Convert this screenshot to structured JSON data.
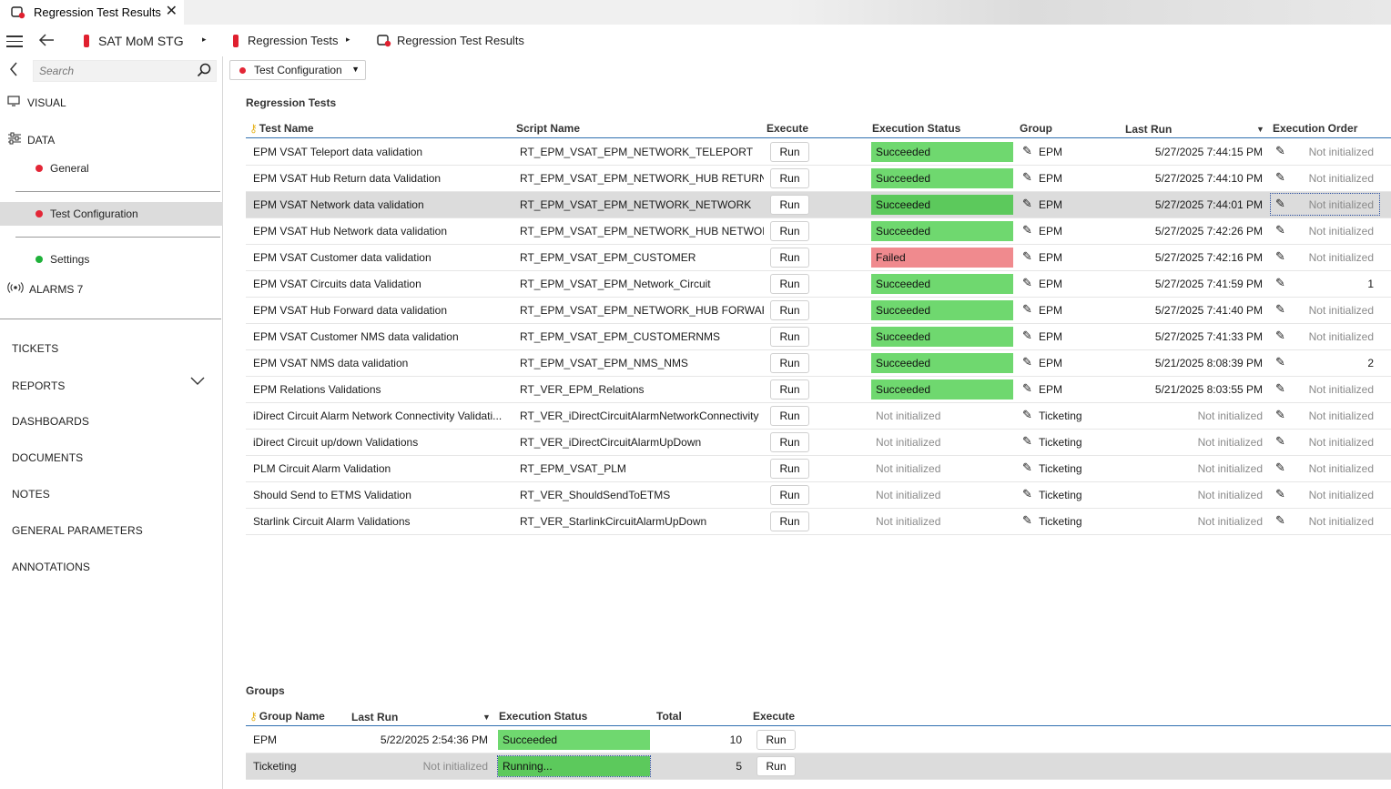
{
  "tab": {
    "title": "Regression Test Results",
    "close": "✕"
  },
  "breadcrumb": {
    "items": [
      "SAT MoM STG",
      "Regression Tests",
      "Regression Test Results"
    ],
    "separator": "▸"
  },
  "sidebar": {
    "search_placeholder": "Search",
    "visual": "VISUAL",
    "data": "DATA",
    "data_items": [
      {
        "label": "General",
        "status": "red"
      },
      {
        "label": "Test Configuration",
        "status": "red",
        "selected": true
      },
      {
        "label": "Settings",
        "status": "green"
      }
    ],
    "alarms": "ALARMS 7",
    "menu": [
      "TICKETS",
      "REPORTS",
      "DASHBOARDS",
      "DOCUMENTS",
      "NOTES",
      "GENERAL PARAMETERS",
      "ANNOTATIONS"
    ]
  },
  "main": {
    "dropdown_label": "Test Configuration",
    "tests_title": "Regression Tests",
    "tests_columns": [
      "Test Name",
      "Script Name",
      "Execute",
      "Execution Status",
      "Group",
      "Last Run",
      "Execution Order"
    ],
    "tests": [
      {
        "name": "EPM VSAT Teleport data validation",
        "script": "RT_EPM_VSAT_EPM_NETWORK_TELEPORT",
        "execute": "Run",
        "status": "Succeeded",
        "group": "EPM",
        "last_run": "5/27/2025 7:44:15 PM",
        "order": "Not initialized"
      },
      {
        "name": "EPM VSAT Hub Return data Validation",
        "script": "RT_EPM_VSAT_EPM_NETWORK_HUB RETURN",
        "execute": "Run",
        "status": "Succeeded",
        "group": "EPM",
        "last_run": "5/27/2025 7:44:10 PM",
        "order": "Not initialized"
      },
      {
        "name": "EPM VSAT Network data validation",
        "script": "RT_EPM_VSAT_EPM_NETWORK_NETWORK",
        "execute": "Run",
        "status": "Succeeded",
        "group": "EPM",
        "last_run": "5/27/2025 7:44:01 PM",
        "order": "Not initialized"
      },
      {
        "name": "EPM VSAT Hub Network data validation",
        "script": "RT_EPM_VSAT_EPM_NETWORK_HUB NETWORK",
        "execute": "Run",
        "status": "Succeeded",
        "group": "EPM",
        "last_run": "5/27/2025 7:42:26 PM",
        "order": "Not initialized"
      },
      {
        "name": "EPM VSAT Customer data validation",
        "script": "RT_EPM_VSAT_EPM_CUSTOMER",
        "execute": "Run",
        "status": "Failed",
        "group": "EPM",
        "last_run": "5/27/2025 7:42:16 PM",
        "order": "Not initialized"
      },
      {
        "name": "EPM VSAT Circuits data Validation",
        "script": "RT_EPM_VSAT_EPM_Network_Circuit",
        "execute": "Run",
        "status": "Succeeded",
        "group": "EPM",
        "last_run": "5/27/2025 7:41:59 PM",
        "order": "1"
      },
      {
        "name": "EPM VSAT Hub Forward data validation",
        "script": "RT_EPM_VSAT_EPM_NETWORK_HUB FORWARD",
        "execute": "Run",
        "status": "Succeeded",
        "group": "EPM",
        "last_run": "5/27/2025 7:41:40 PM",
        "order": "Not initialized"
      },
      {
        "name": "EPM VSAT Customer NMS data validation",
        "script": "RT_EPM_VSAT_EPM_CUSTOMERNMS",
        "execute": "Run",
        "status": "Succeeded",
        "group": "EPM",
        "last_run": "5/27/2025 7:41:33 PM",
        "order": "Not initialized"
      },
      {
        "name": "EPM VSAT NMS data validation",
        "script": "RT_EPM_VSAT_EPM_NMS_NMS",
        "execute": "Run",
        "status": "Succeeded",
        "group": "EPM",
        "last_run": "5/21/2025 8:08:39 PM",
        "order": "2"
      },
      {
        "name": "EPM Relations Validations",
        "script": "RT_VER_EPM_Relations",
        "execute": "Run",
        "status": "Succeeded",
        "group": "EPM",
        "last_run": "5/21/2025 8:03:55 PM",
        "order": "Not initialized"
      },
      {
        "name": "iDirect Circuit Alarm Network Connectivity Validati...",
        "script": "RT_VER_iDirectCircuitAlarmNetworkConnectivity",
        "execute": "Run",
        "status": "Not initialized",
        "group": "Ticketing",
        "last_run": "Not initialized",
        "order": "Not initialized"
      },
      {
        "name": "iDirect Circuit up/down Validations",
        "script": "RT_VER_iDirectCircuitAlarmUpDown",
        "execute": "Run",
        "status": "Not initialized",
        "group": "Ticketing",
        "last_run": "Not initialized",
        "order": "Not initialized"
      },
      {
        "name": "PLM Circuit Alarm Validation",
        "script": "RT_EPM_VSAT_PLM",
        "execute": "Run",
        "status": "Not initialized",
        "group": "Ticketing",
        "last_run": "Not initialized",
        "order": "Not initialized"
      },
      {
        "name": "Should Send to ETMS Validation",
        "script": "RT_VER_ShouldSendToETMS",
        "execute": "Run",
        "status": "Not initialized",
        "group": "Ticketing",
        "last_run": "Not initialized",
        "order": "Not initialized"
      },
      {
        "name": "Starlink Circuit Alarm Validations",
        "script": "RT_VER_StarlinkCircuitAlarmUpDown",
        "execute": "Run",
        "status": "Not initialized",
        "group": "Ticketing",
        "last_run": "Not initialized",
        "order": "Not initialized"
      }
    ],
    "selected_test_index": 2,
    "groups_title": "Groups",
    "groups_columns": [
      "Group Name",
      "Last Run",
      "Execution Status",
      "Total",
      "Execute"
    ],
    "groups": [
      {
        "name": "EPM",
        "last_run": "5/22/2025 2:54:36 PM",
        "status": "Succeeded",
        "total": "10",
        "execute": "Run"
      },
      {
        "name": "Ticketing",
        "last_run": "Not initialized",
        "status": "Running...",
        "total": "5",
        "execute": "Run"
      }
    ],
    "colors": {
      "succeeded": "#6fd86f",
      "failed": "#f08a8e",
      "selection": "#dcdcdc",
      "header_line": "#2f6fb0"
    }
  }
}
